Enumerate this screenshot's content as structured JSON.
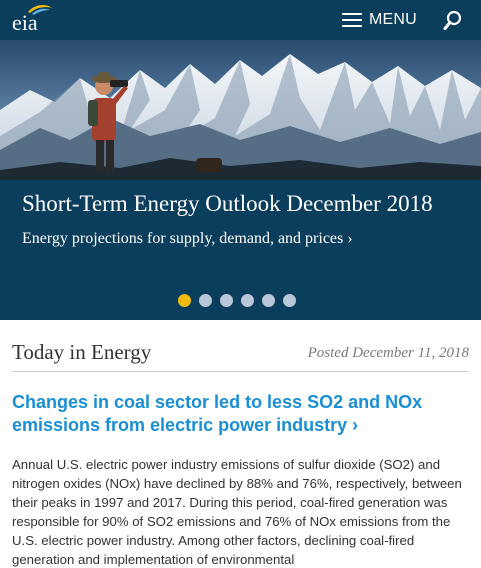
{
  "header": {
    "logo_text": "eia",
    "menu_label": "MENU",
    "icons": {
      "menu": "hamburger-icon",
      "search": "search-icon",
      "logo": "eia-logo"
    },
    "colors": {
      "bar": "#0b3d5c",
      "text": "#ffffff"
    }
  },
  "carousel": {
    "title": "Short-Term Energy Outlook December 2018",
    "subtitle": "Energy projections for supply, demand, and prices ›",
    "slide_count": 6,
    "active_index": 0,
    "colors": {
      "band": "#0b3d5c",
      "dot_active": "#f2b90f",
      "dot_inactive": "#b9c8d8"
    }
  },
  "today": {
    "heading": "Today in Energy",
    "posted": "Posted December 11, 2018",
    "article": {
      "title": "Changes in coal sector led to less SO2 and NOx emissions from electric power industry ›",
      "body": "Annual U.S. electric power industry emissions of sulfur dioxide (SO2) and nitrogen oxides (NOx) have declined by 88% and 76%, respectively, between their peaks in 1997 and 2017. During this period, coal-fired generation was responsible for 90% of SO2 emissions and 76% of NOx emissions from the U.S. electric power industry. Among other factors, declining coal-fired generation and implementation of environmental"
    },
    "colors": {
      "link": "#1a8fd3",
      "body": "#333333"
    }
  }
}
